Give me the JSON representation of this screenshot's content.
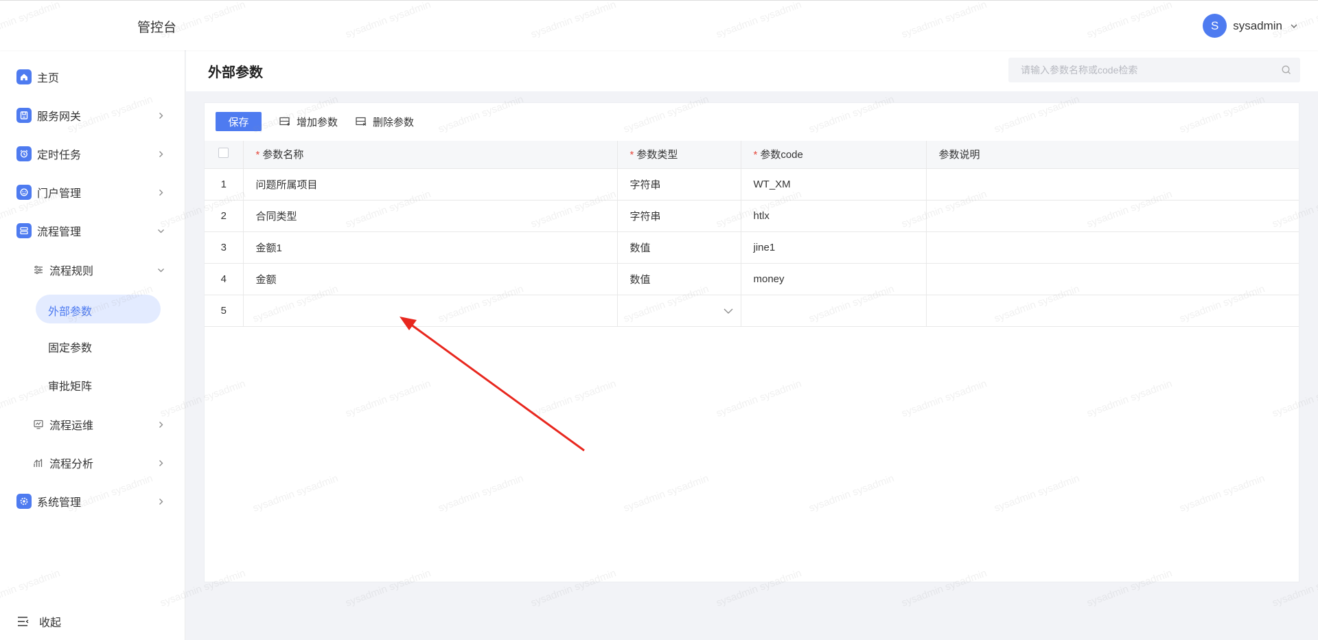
{
  "header": {
    "app_title": "管控台",
    "avatar_initial": "S",
    "username": "sysadmin"
  },
  "sidebar": {
    "items": [
      {
        "label": "主页",
        "icon": "home-icon"
      },
      {
        "label": "服务网关",
        "icon": "gateway-icon"
      },
      {
        "label": "定时任务",
        "icon": "alarm-clock-icon"
      },
      {
        "label": "门户管理",
        "icon": "smile-icon"
      },
      {
        "label": "流程管理",
        "icon": "workflow-icon"
      },
      {
        "label": "系统管理",
        "icon": "settings-icon"
      }
    ],
    "sub_items": [
      {
        "label": "流程规则",
        "icon": "sliders-icon"
      },
      {
        "label": "流程运维",
        "icon": "monitor-icon"
      },
      {
        "label": "流程分析",
        "icon": "chart-icon"
      }
    ],
    "leaf_items": [
      "外部参数",
      "固定参数",
      "审批矩阵"
    ],
    "collapse_label": "收起"
  },
  "page": {
    "title": "外部参数",
    "search_placeholder": "请输入参数名称或code检索"
  },
  "toolbar": {
    "save": "保存",
    "add": "增加参数",
    "delete": "删除参数"
  },
  "table": {
    "columns": {
      "name": "参数名称",
      "type": "参数类型",
      "code": "参数code",
      "desc": "参数说明"
    },
    "required_mark": "*",
    "rows": [
      {
        "idx": "1",
        "name": "问题所属项目",
        "type": "字符串",
        "code": "WT_XM",
        "desc": ""
      },
      {
        "idx": "2",
        "name": "合同类型",
        "type": "字符串",
        "code": "htlx",
        "desc": ""
      },
      {
        "idx": "3",
        "name": "金额1",
        "type": "数值",
        "code": "jine1",
        "desc": ""
      },
      {
        "idx": "4",
        "name": "金额",
        "type": "数值",
        "code": "money",
        "desc": ""
      },
      {
        "idx": "5",
        "name": "",
        "type": "",
        "code": "",
        "desc": ""
      }
    ]
  },
  "watermark_text": "sysadmin",
  "colors": {
    "primary": "#4e7bf0",
    "active_bg": "#e3ebff",
    "required": "#e5483c",
    "annotation_arrow": "#e8271e"
  }
}
